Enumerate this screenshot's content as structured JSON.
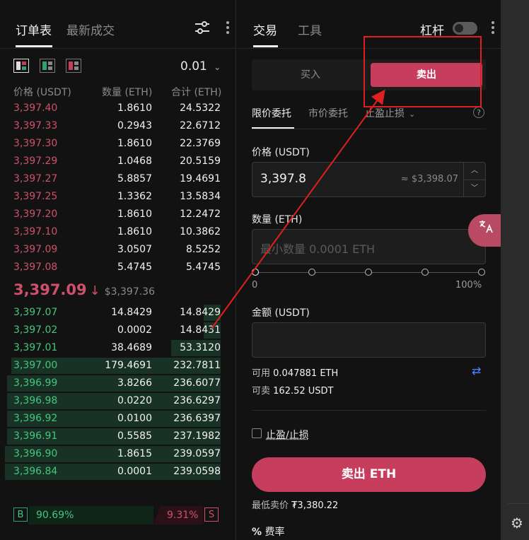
{
  "orderbook": {
    "tabs": [
      "订单表",
      "最新成交"
    ],
    "precision": "0.01",
    "headers": {
      "price": "价格 (USDT)",
      "qty": "数量 (ETH)",
      "total": "合计 (ETH)"
    },
    "asks": [
      {
        "price": "3,397.40",
        "qty": "1.8610",
        "total": "24.5322"
      },
      {
        "price": "3,397.33",
        "qty": "0.2943",
        "total": "22.6712"
      },
      {
        "price": "3,397.30",
        "qty": "1.8610",
        "total": "22.3769"
      },
      {
        "price": "3,397.29",
        "qty": "1.0468",
        "total": "20.5159"
      },
      {
        "price": "3,397.27",
        "qty": "5.8857",
        "total": "19.4691"
      },
      {
        "price": "3,397.25",
        "qty": "1.3362",
        "total": "13.5834"
      },
      {
        "price": "3,397.20",
        "qty": "1.8610",
        "total": "12.2472"
      },
      {
        "price": "3,397.10",
        "qty": "1.8610",
        "total": "10.3862"
      },
      {
        "price": "3,397.09",
        "qty": "3.0507",
        "total": "8.5252"
      },
      {
        "price": "3,397.08",
        "qty": "5.4745",
        "total": "5.4745"
      }
    ],
    "last_price": "3,397.09",
    "last_price_usd": "$3,397.36",
    "bids": [
      {
        "price": "3,397.07",
        "qty": "14.8429",
        "total": "14.8429",
        "depth": 0.08
      },
      {
        "price": "3,397.02",
        "qty": "0.0002",
        "total": "14.8431",
        "depth": 0.08
      },
      {
        "price": "3,397.01",
        "qty": "38.4689",
        "total": "53.3120",
        "depth": 0.23
      },
      {
        "price": "3,397.00",
        "qty": "179.4691",
        "total": "232.7811",
        "depth": 0.97
      },
      {
        "price": "3,396.99",
        "qty": "3.8266",
        "total": "236.6077",
        "depth": 0.99
      },
      {
        "price": "3,396.98",
        "qty": "0.0220",
        "total": "236.6297",
        "depth": 0.99
      },
      {
        "price": "3,396.92",
        "qty": "0.0100",
        "total": "236.6397",
        "depth": 0.99
      },
      {
        "price": "3,396.91",
        "qty": "0.5585",
        "total": "237.1982",
        "depth": 0.99
      },
      {
        "price": "3,396.90",
        "qty": "1.8615",
        "total": "239.0597",
        "depth": 1.0
      },
      {
        "price": "3,396.84",
        "qty": "0.0001",
        "total": "239.0598",
        "depth": 1.0
      }
    ],
    "buy_ratio_label": "B",
    "buy_ratio": "90.69%",
    "sell_ratio": "9.31%",
    "sell_ratio_label": "S"
  },
  "trade": {
    "tabs": [
      "交易",
      "工具"
    ],
    "leverage_label": "杠杆",
    "buy_label": "买入",
    "sell_label": "卖出",
    "order_types": [
      "限价委托",
      "市价委托",
      "止盈止损"
    ],
    "price_label": "价格 (USDT)",
    "price_value": "3,397.8",
    "price_hint": "≈ $3,398.07",
    "qty_label": "数量 (ETH)",
    "qty_placeholder": "最小数量 0.0001 ETH",
    "slider_min": "0",
    "slider_max": "100%",
    "amount_label": "金额 (USDT)",
    "available_label": "可用",
    "available_value": "0.047881 ETH",
    "sellable_label": "可卖",
    "sellable_value": "162.52 USDT",
    "tpsl_label": "止盈/止损",
    "submit_label": "卖出 ETH",
    "min_price_label": "最低卖价",
    "min_price_value": "₮3,380.22",
    "fee_label": "费率"
  },
  "colors": {
    "sell": "#c63d5d",
    "buy": "#2ea36b",
    "annotation": "#e01f1f"
  }
}
